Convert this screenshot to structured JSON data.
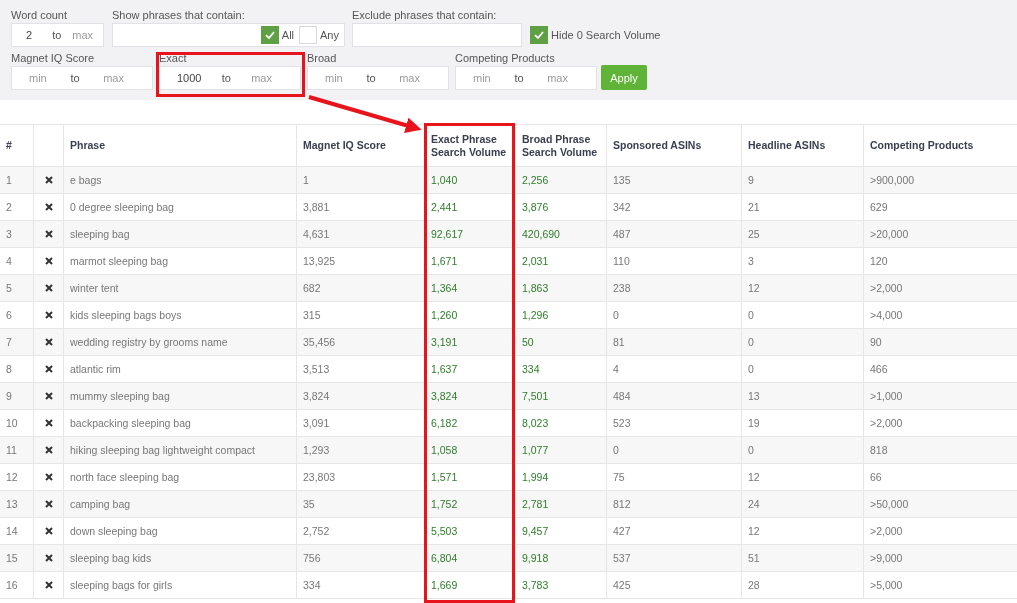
{
  "filters": {
    "word_count": {
      "label": "Word count",
      "min": {
        "value": "2"
      },
      "to": "to",
      "max": {
        "placeholder": "max"
      }
    },
    "show_phrases": {
      "label": "Show phrases that contain:",
      "options": [
        {
          "label": "All",
          "checked": true
        },
        {
          "label": "Any",
          "checked": false
        }
      ]
    },
    "exclude_phrases": {
      "label": "Exclude phrases that contain:"
    },
    "hide_zero": {
      "label": "Hide 0 Search Volume",
      "checked": true
    },
    "ranges": [
      {
        "label": "Magnet IQ Score",
        "min": {
          "placeholder": "min"
        },
        "to": "to",
        "max": {
          "placeholder": "max"
        }
      },
      {
        "label": "Exact",
        "min": {
          "value": "1000"
        },
        "to": "to",
        "max": {
          "placeholder": "max"
        }
      },
      {
        "label": "Broad",
        "min": {
          "placeholder": "min"
        },
        "to": "to",
        "max": {
          "placeholder": "max"
        }
      },
      {
        "label": "Competing Products",
        "min": {
          "placeholder": "min"
        },
        "to": "to",
        "max": {
          "placeholder": "max"
        }
      }
    ],
    "apply_button": "Apply"
  },
  "table": {
    "columns": [
      "#",
      "Phrase",
      "Magnet IQ Score",
      "Exact Phrase Search Volume",
      "Broad Phrase Search Volume",
      "Sponsored ASINs",
      "Headline ASINs",
      "Competing Products"
    ],
    "rows": [
      {
        "number": "1",
        "phrase": "e bags",
        "magnet_iq": "1",
        "exact": "1,040",
        "broad": "2,256",
        "sponsored": "135",
        "headline": "9",
        "competing": ">900,000"
      },
      {
        "number": "2",
        "phrase": "0 degree sleeping bag",
        "magnet_iq": "3,881",
        "exact": "2,441",
        "broad": "3,876",
        "sponsored": "342",
        "headline": "21",
        "competing": "629"
      },
      {
        "number": "3",
        "phrase": "sleeping bag",
        "magnet_iq": "4,631",
        "exact": "92,617",
        "broad": "420,690",
        "sponsored": "487",
        "headline": "25",
        "competing": ">20,000"
      },
      {
        "number": "4",
        "phrase": "marmot sleeping bag",
        "magnet_iq": "13,925",
        "exact": "1,671",
        "broad": "2,031",
        "sponsored": "110",
        "headline": "3",
        "competing": "120"
      },
      {
        "number": "5",
        "phrase": "winter tent",
        "magnet_iq": "682",
        "exact": "1,364",
        "broad": "1,863",
        "sponsored": "238",
        "headline": "12",
        "competing": ">2,000"
      },
      {
        "number": "6",
        "phrase": "kids sleeping bags boys",
        "magnet_iq": "315",
        "exact": "1,260",
        "broad": "1,296",
        "sponsored": "0",
        "headline": "0",
        "competing": ">4,000"
      },
      {
        "number": "7",
        "phrase": "wedding registry by grooms name",
        "magnet_iq": "35,456",
        "exact": "3,191",
        "broad": "50",
        "sponsored": "81",
        "headline": "0",
        "competing": "90"
      },
      {
        "number": "8",
        "phrase": "atlantic rim",
        "magnet_iq": "3,513",
        "exact": "1,637",
        "broad": "334",
        "sponsored": "4",
        "headline": "0",
        "competing": "466"
      },
      {
        "number": "9",
        "phrase": "mummy sleeping bag",
        "magnet_iq": "3,824",
        "exact": "3,824",
        "broad": "7,501",
        "sponsored": "484",
        "headline": "13",
        "competing": ">1,000"
      },
      {
        "number": "10",
        "phrase": "backpacking sleeping bag",
        "magnet_iq": "3,091",
        "exact": "6,182",
        "broad": "8,023",
        "sponsored": "523",
        "headline": "19",
        "competing": ">2,000"
      },
      {
        "number": "11",
        "phrase": "hiking sleeping bag lightweight compact",
        "magnet_iq": "1,293",
        "exact": "1,058",
        "broad": "1,077",
        "sponsored": "0",
        "headline": "0",
        "competing": "818"
      },
      {
        "number": "12",
        "phrase": "north face sleeping bag",
        "magnet_iq": "23,803",
        "exact": "1,571",
        "broad": "1,994",
        "sponsored": "75",
        "headline": "12",
        "competing": "66"
      },
      {
        "number": "13",
        "phrase": "camping bag",
        "magnet_iq": "35",
        "exact": "1,752",
        "broad": "2,781",
        "sponsored": "812",
        "headline": "24",
        "competing": ">50,000"
      },
      {
        "number": "14",
        "phrase": "down sleeping bag",
        "magnet_iq": "2,752",
        "exact": "5,503",
        "broad": "9,457",
        "sponsored": "427",
        "headline": "12",
        "competing": ">2,000"
      },
      {
        "number": "15",
        "phrase": "sleeping bag kids",
        "magnet_iq": "756",
        "exact": "6,804",
        "broad": "9,918",
        "sponsored": "537",
        "headline": "51",
        "competing": ">9,000"
      },
      {
        "number": "16",
        "phrase": "sleeping bags for girls",
        "magnet_iq": "334",
        "exact": "1,669",
        "broad": "3,783",
        "sponsored": "425",
        "headline": "28",
        "competing": ">5,000"
      }
    ]
  }
}
